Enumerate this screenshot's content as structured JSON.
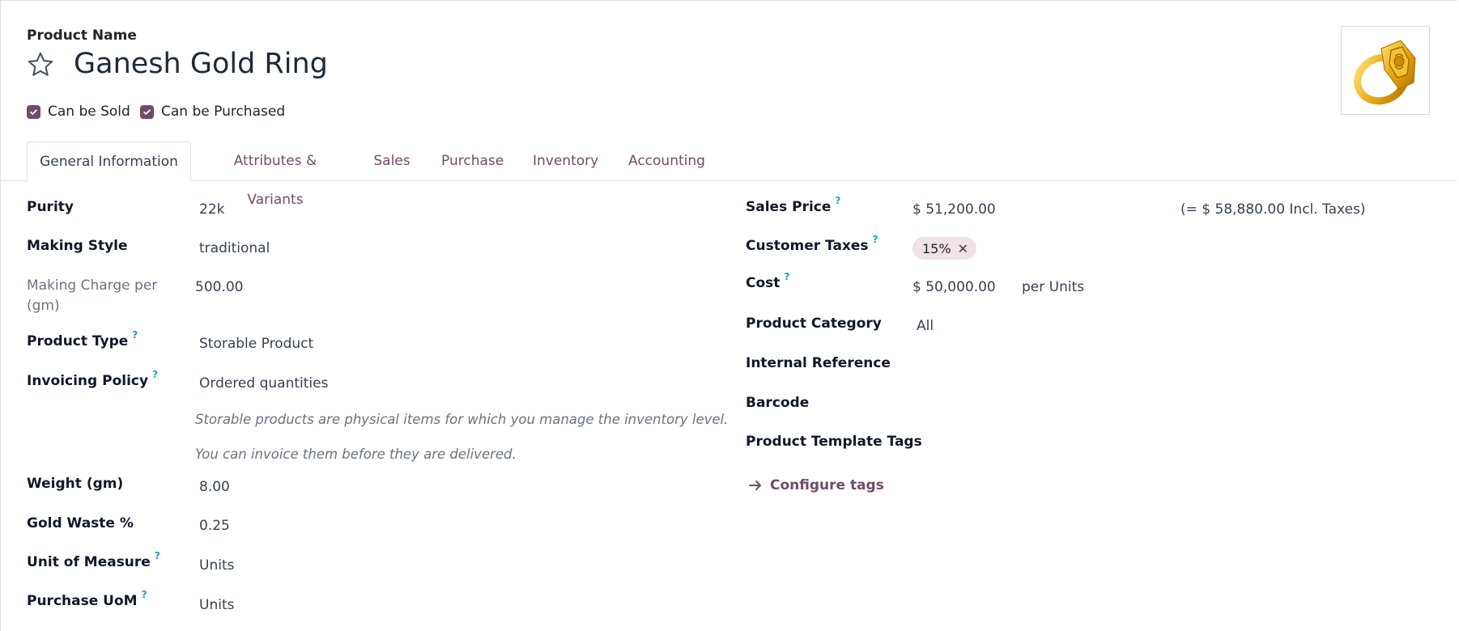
{
  "product_name_label": "Product Name",
  "product_name": "Ganesh Gold Ring",
  "flags": {
    "can_be_sold": "Can be Sold",
    "can_be_purchased": "Can be Purchased"
  },
  "tabs": [
    {
      "label": "General Information"
    },
    {
      "label": "Attributes & Variants"
    },
    {
      "label": "Sales"
    },
    {
      "label": "Purchase"
    },
    {
      "label": "Inventory"
    },
    {
      "label": "Accounting"
    }
  ],
  "left_fields": {
    "purity": {
      "label": "Purity",
      "value": "22k"
    },
    "making_style": {
      "label": "Making Style",
      "value": "traditional"
    },
    "making_charge": {
      "label": "Making Charge per (gm)",
      "value": "500.00"
    },
    "product_type": {
      "label": "Product Type",
      "value": "Storable Product"
    },
    "invoicing_policy": {
      "label": "Invoicing Policy",
      "value": "Ordered quantities"
    },
    "note_1": "Storable products are physical items for which you manage the inventory level.",
    "note_2": "You can invoice them before they are delivered.",
    "weight": {
      "label": "Weight (gm)",
      "value": "8.00"
    },
    "gold_waste": {
      "label": "Gold Waste %",
      "value": "0.25"
    },
    "uom": {
      "label": "Unit of Measure",
      "value": "Units"
    },
    "purchase_uom": {
      "label": "Purchase UoM",
      "value": "Units"
    }
  },
  "right_fields": {
    "sales_price": {
      "label": "Sales Price",
      "value": "$ 51,200.00",
      "incl_taxes": "(= $ 58,880.00 Incl. Taxes)"
    },
    "customer_taxes": {
      "label": "Customer Taxes",
      "tag": "15%"
    },
    "cost": {
      "label": "Cost",
      "value": "$ 50,000.00",
      "unit": "per Units"
    },
    "product_category": {
      "label": "Product Category",
      "value": "All"
    },
    "internal_reference": {
      "label": "Internal Reference"
    },
    "barcode": {
      "label": "Barcode"
    },
    "template_tags": {
      "label": "Product Template Tags"
    },
    "configure_tags": "Configure tags"
  },
  "help_mark": "?",
  "colors": {
    "accent": "#714b67",
    "help": "#0ba5bd",
    "tag_bg": "#efe3e6"
  }
}
